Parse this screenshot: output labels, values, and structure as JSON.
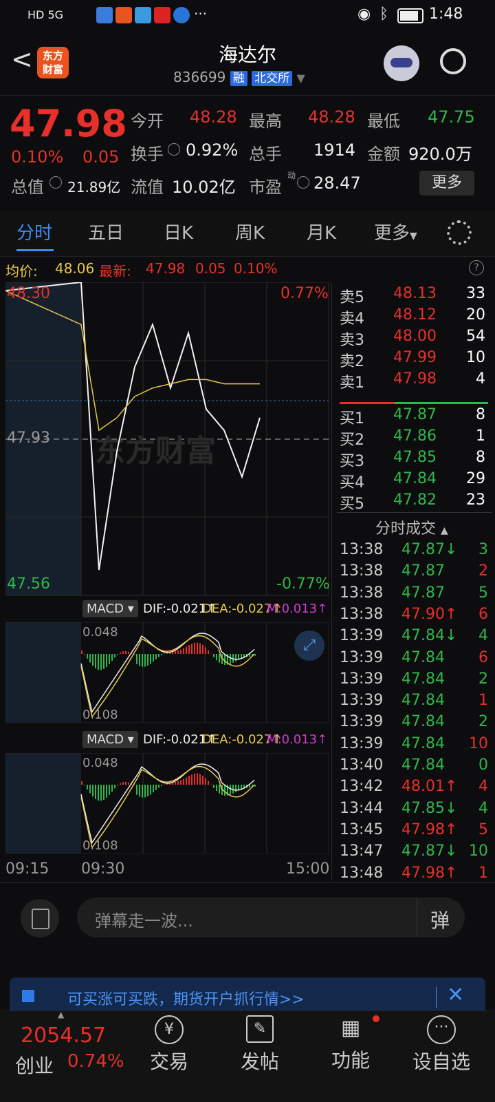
{
  "status_bar": {
    "left_text": "HD 5G",
    "time": "1:48",
    "more": "···"
  },
  "header": {
    "logo_line1": "东方",
    "logo_line2": "财富",
    "stock_name": "海达尔",
    "stock_code": "836699",
    "tag_rong": "融",
    "tag_exchange": "北交所"
  },
  "quote": {
    "price": "47.98",
    "change_pct": "0.10%",
    "change_amt": "0.05",
    "open_label": "今开",
    "open": "48.28",
    "high_label": "最高",
    "high": "48.28",
    "low_label": "最低",
    "low": "47.75",
    "turnover_label": "换手",
    "turnover": "0.92%",
    "volume_label": "总手",
    "volume": "1914",
    "amount_label": "金额",
    "amount": "920.0万",
    "mktcap_label": "总值",
    "mktcap": "21.89亿",
    "float_label": "流值",
    "float_value": "10.02亿",
    "pe_label": "市盈",
    "pe_sup": "动",
    "pe": "28.47",
    "more_button": "更多"
  },
  "tabs": [
    "分时",
    "五日",
    "日K",
    "周K",
    "月K",
    "更多"
  ],
  "info_line": {
    "avg_label": "均价:",
    "avg": "48.06",
    "latest_label": "最新:",
    "latest": "47.98",
    "chg": "0.05",
    "pct": "0.10%"
  },
  "chart": {
    "top_price": "48.30",
    "top_pct": "0.77%",
    "mid_price": "47.93",
    "bottom_price": "47.56",
    "bottom_pct": "-0.77%",
    "macd_label": "MACD",
    "dif": "DIF:-0.021↑",
    "dea": "DEA:-0.027↑",
    "m": "M:0.013↑",
    "macd_top": "0.048",
    "macd_bottom": "0.108",
    "time_start": "09:15",
    "time_mid": "09:30",
    "time_end": "15:00",
    "watermark": "东方财富"
  },
  "chart_data": {
    "type": "line",
    "title": "",
    "x_labels": [
      "09:15",
      "09:30",
      "15:00"
    ],
    "ylim": [
      47.56,
      48.3
    ],
    "series": [
      {
        "name": "最新",
        "values": [
          48.28,
          48.3,
          47.62,
          47.9,
          48.1,
          48.2,
          48.05,
          48.18,
          48.0,
          47.95,
          47.84,
          47.98
        ]
      },
      {
        "name": "均价",
        "values": [
          48.28,
          48.2,
          47.95,
          47.98,
          48.03,
          48.05,
          48.06,
          48.07,
          48.07,
          48.06,
          48.06,
          48.06
        ]
      }
    ]
  },
  "orderbook": {
    "asks": [
      {
        "label": "卖5",
        "price": "48.13",
        "vol": "33"
      },
      {
        "label": "卖4",
        "price": "48.12",
        "vol": "20"
      },
      {
        "label": "卖3",
        "price": "48.00",
        "vol": "54"
      },
      {
        "label": "卖2",
        "price": "47.99",
        "vol": "10"
      },
      {
        "label": "卖1",
        "price": "47.98",
        "vol": "4"
      }
    ],
    "bids": [
      {
        "label": "买1",
        "price": "47.87",
        "vol": "8"
      },
      {
        "label": "买2",
        "price": "47.86",
        "vol": "1"
      },
      {
        "label": "买3",
        "price": "47.85",
        "vol": "8"
      },
      {
        "label": "买4",
        "price": "47.84",
        "vol": "29"
      },
      {
        "label": "买5",
        "price": "47.82",
        "vol": "23"
      }
    ],
    "trades_title": "分时成交",
    "trades": [
      {
        "time": "13:38",
        "price": "47.87↓",
        "vol": "3",
        "dir": "down"
      },
      {
        "time": "13:38",
        "price": "47.87",
        "vol": "2",
        "dir": "flat"
      },
      {
        "time": "13:38",
        "price": "47.87",
        "vol": "5",
        "dir": "flat"
      },
      {
        "time": "13:38",
        "price": "47.90↑",
        "vol": "6",
        "dir": "up"
      },
      {
        "time": "13:39",
        "price": "47.84↓",
        "vol": "4",
        "dir": "down"
      },
      {
        "time": "13:39",
        "price": "47.84",
        "vol": "6",
        "dir": "flat"
      },
      {
        "time": "13:39",
        "price": "47.84",
        "vol": "2",
        "dir": "flat"
      },
      {
        "time": "13:39",
        "price": "47.84",
        "vol": "1",
        "dir": "flat"
      },
      {
        "time": "13:39",
        "price": "47.84",
        "vol": "2",
        "dir": "flat"
      },
      {
        "time": "13:39",
        "price": "47.84",
        "vol": "10",
        "dir": "flat"
      },
      {
        "time": "13:40",
        "price": "47.84",
        "vol": "0",
        "dir": "flat"
      },
      {
        "time": "13:42",
        "price": "48.01↑",
        "vol": "4",
        "dir": "up"
      },
      {
        "time": "13:44",
        "price": "47.85↓",
        "vol": "4",
        "dir": "down"
      },
      {
        "time": "13:45",
        "price": "47.98↑",
        "vol": "5",
        "dir": "up"
      },
      {
        "time": "13:47",
        "price": "47.87↓",
        "vol": "10",
        "dir": "down"
      },
      {
        "time": "13:48",
        "price": "47.98↑",
        "vol": "1",
        "dir": "up"
      }
    ]
  },
  "comment": {
    "placeholder": "弹幕走一波...",
    "danmu": "弹"
  },
  "banner": {
    "text": "可买涨可买跌，期货开户抓行情>>"
  },
  "bottom_nav": {
    "index_value": "2054.57",
    "index_name": "创业",
    "index_pct": "0.74%",
    "items": [
      "交易",
      "发帖",
      "功能",
      "设自选"
    ]
  },
  "colors": {
    "up": "#e8302a",
    "down": "#2fb84a",
    "avg_line": "#e7c94a",
    "accent": "#2b6ae0"
  }
}
